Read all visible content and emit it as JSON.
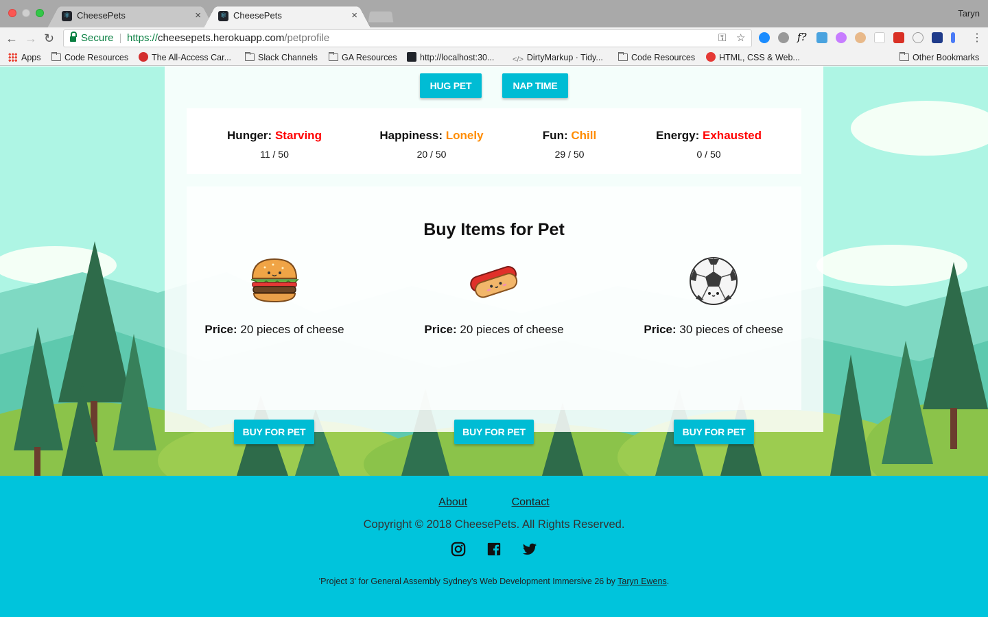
{
  "browser": {
    "tabs": [
      {
        "title": "CheesePets",
        "close": "×"
      },
      {
        "title": "CheesePets",
        "close": "×"
      }
    ],
    "profile": "Taryn",
    "address": {
      "secure_label": "Secure",
      "scheme": "https://",
      "host": "cheesepets.herokuapp.com",
      "path": "/petprofile"
    },
    "bookmarks": [
      "Apps",
      "Code Resources",
      "The All-Access Car...",
      "Slack Channels",
      "GA Resources",
      "http://localhost:30...",
      "DirtyMarkup · Tidy...",
      "Code Resources",
      "HTML, CSS & Web...",
      "Other Bookmarks"
    ]
  },
  "actions": {
    "hug": "HUG PET",
    "nap": "NAP TIME"
  },
  "stats": [
    {
      "label": "Hunger:",
      "status": "Starving",
      "value": "11 / 50",
      "color": "#ff0000"
    },
    {
      "label": "Happiness:",
      "status": "Lonely",
      "value": "20 / 50",
      "color": "#ff8c00"
    },
    {
      "label": "Fun:",
      "status": "Chill",
      "value": "29 / 50",
      "color": "#ff8c00"
    },
    {
      "label": "Energy:",
      "status": "Exhausted",
      "value": "0 / 50",
      "color": "#ff0000"
    }
  ],
  "shop": {
    "title": "Buy Items for Pet",
    "price_label": "Price:",
    "items": [
      {
        "icon": "burger-icon",
        "price": "20 pieces of cheese",
        "button": "BUY FOR PET"
      },
      {
        "icon": "hotdog-icon",
        "price": "20 pieces of cheese",
        "button": "BUY FOR PET"
      },
      {
        "icon": "soccer-ball-icon",
        "price": "30 pieces of cheese",
        "button": "BUY FOR PET"
      }
    ]
  },
  "footer": {
    "links": [
      "About",
      "Contact"
    ],
    "copyright": "Copyright © 2018 CheesePets. All Rights Reserved.",
    "social": [
      "instagram-icon",
      "facebook-icon",
      "twitter-icon"
    ],
    "credit_prefix": "'Project 3' for General Assembly Sydney's Web Development Immersive 26 by ",
    "credit_name": "Taryn Ewens",
    "credit_suffix": "."
  },
  "colors": {
    "accent": "#00bcd4",
    "footer_bg": "#00c4dc",
    "sky": "#aef5e4",
    "status_red": "#ff0000",
    "status_orange": "#ff8c00"
  }
}
